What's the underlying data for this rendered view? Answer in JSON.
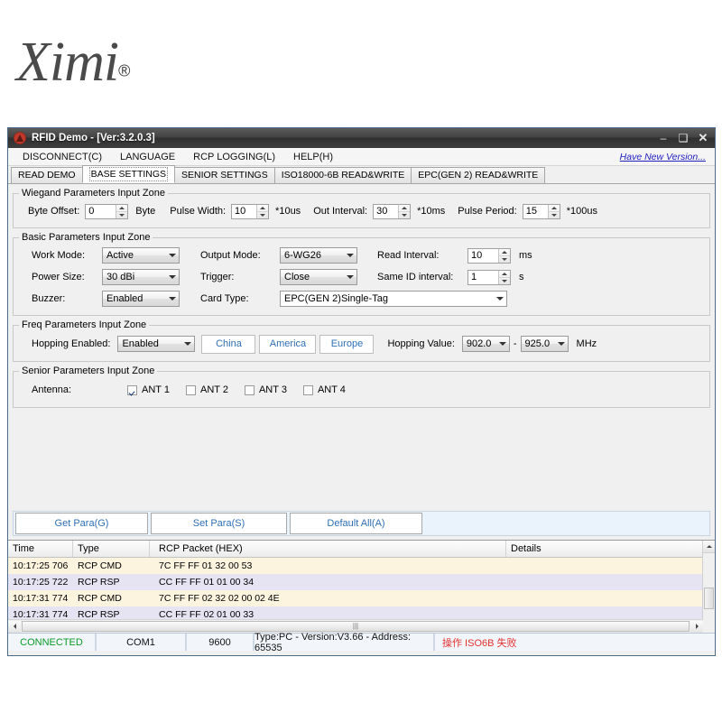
{
  "logo": {
    "text": "Ximi",
    "registered": "®"
  },
  "window": {
    "title": "RFID Demo - [Ver:3.2.0.3]",
    "minimize": "–",
    "maximize": "❑",
    "close": "✕"
  },
  "menubar": {
    "items": [
      {
        "label": "DISCONNECT(C)"
      },
      {
        "label": "LANGUAGE"
      },
      {
        "label": "RCP LOGGING(L)"
      },
      {
        "label": "HELP(H)"
      }
    ],
    "new_version_link": "Have New Version..."
  },
  "tabs": [
    {
      "label": "READ DEMO",
      "active": false
    },
    {
      "label": "BASE SETTINGS",
      "active": true
    },
    {
      "label": "SENIOR SETTINGS",
      "active": false
    },
    {
      "label": "ISO18000-6B READ&WRITE",
      "active": false
    },
    {
      "label": "EPC(GEN 2) READ&WRITE",
      "active": false
    }
  ],
  "wiegand": {
    "legend": "Wiegand Parameters Input Zone",
    "byte_offset_label": "Byte Offset:",
    "byte_offset_value": "0",
    "byte_unit": "Byte",
    "pulse_width_label": "Pulse Width:",
    "pulse_width_value": "10",
    "pulse_width_unit": "*10us",
    "out_interval_label": "Out Interval:",
    "out_interval_value": "30",
    "out_interval_unit": "*10ms",
    "pulse_period_label": "Pulse Period:",
    "pulse_period_value": "15",
    "pulse_period_unit": "*100us"
  },
  "basic": {
    "legend": "Basic Parameters Input Zone",
    "work_mode_label": "Work Mode:",
    "work_mode_value": "Active",
    "power_size_label": "Power Size:",
    "power_size_value": "30 dBi",
    "buzzer_label": "Buzzer:",
    "buzzer_value": "Enabled",
    "output_mode_label": "Output Mode:",
    "output_mode_value": "6-WG26",
    "trigger_label": "Trigger:",
    "trigger_value": "Close",
    "card_type_label": "Card Type:",
    "card_type_value": "EPC(GEN 2)Single-Tag",
    "read_interval_label": "Read Interval:",
    "read_interval_value": "10",
    "read_interval_unit": "ms",
    "same_id_label": "Same ID interval:",
    "same_id_value": "1",
    "same_id_unit": "s"
  },
  "freq": {
    "legend": "Freq Parameters Input Zone",
    "hopping_enabled_label": "Hopping Enabled:",
    "hopping_enabled_value": "Enabled",
    "region_china": "China",
    "region_america": "America",
    "region_europe": "Europe",
    "hopping_value_label": "Hopping Value:",
    "hopping_from": "902.0",
    "hopping_dash": "-",
    "hopping_to": "925.0",
    "hopping_unit": "MHz"
  },
  "senior": {
    "legend": "Senior Parameters Input Zone",
    "antenna_label": "Antenna:",
    "antennas": [
      {
        "label": "ANT 1",
        "checked": true
      },
      {
        "label": "ANT 2",
        "checked": false
      },
      {
        "label": "ANT 3",
        "checked": false
      },
      {
        "label": "ANT 4",
        "checked": false
      }
    ]
  },
  "actions": [
    {
      "label": "Get Para(G)"
    },
    {
      "label": "Set Para(S)"
    },
    {
      "label": "Default All(A)"
    }
  ],
  "log": {
    "columns": [
      "Time",
      "Type",
      "RCP Packet (HEX)",
      "Details"
    ],
    "rows": [
      {
        "time": "10:17:25 706",
        "type": "RCP CMD",
        "packet": "7C FF FF 01 32 00 53",
        "details": ""
      },
      {
        "time": "10:17:25 722",
        "type": "RCP RSP",
        "packet": "CC FF FF 01 01 00 34",
        "details": ""
      },
      {
        "time": "10:17:31 774",
        "type": "RCP CMD",
        "packet": "7C FF FF 02 32 02 00 02 4E",
        "details": ""
      },
      {
        "time": "10:17:31 774",
        "type": "RCP RSP",
        "packet": "CC FF FF 02 01 00 33",
        "details": ""
      }
    ]
  },
  "statusbar": {
    "connection": "CONNECTED",
    "port": "COM1",
    "baud": "9600",
    "info": "Type:PC - Version:V3.66 - Address: 65535",
    "error": "操作 ISO6B 失败"
  },
  "colors": {
    "accent_blue": "#2f6fb5",
    "link_blue": "#2020c0",
    "connected_green": "#0a9a27",
    "error_red": "#e03131",
    "cmd_row": "#fdf4e0",
    "rsp_row": "#e6e3f3"
  }
}
